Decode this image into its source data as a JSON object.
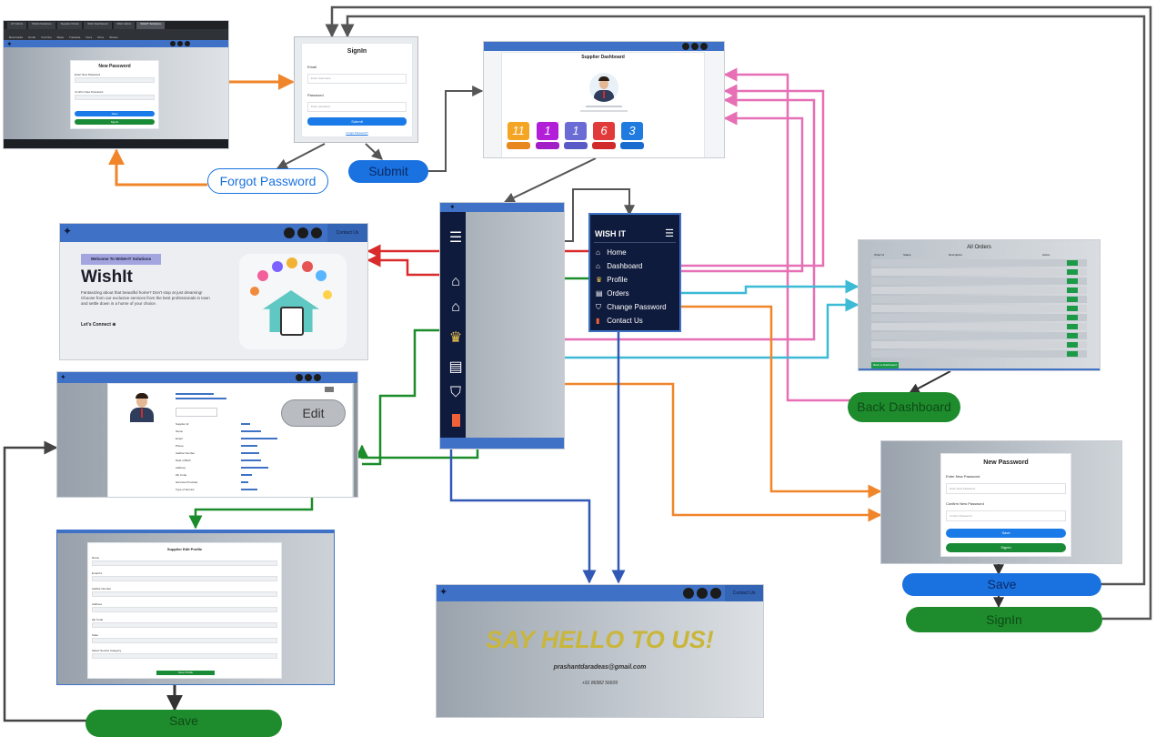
{
  "browser": {
    "tabs": [
      "sIT Admin",
      "Wishit Solutions",
      "Supplier Portal",
      "Wish Dashboard",
      "Wish Admin",
      "WishIT Solutions"
    ],
    "bookmarks": [
      "Bookmarks",
      "Gmail",
      "YouTube",
      "Maps",
      "Translate",
      "Docs",
      "Drive",
      "Sheets"
    ]
  },
  "forgot_page": {
    "title": "New Password",
    "label_new": "Enter New Password",
    "label_confirm": "Confirm New Password",
    "btn_save": "Save",
    "btn_signin": "SignIn"
  },
  "signin_page": {
    "title": "SignIn",
    "email_label": "Email",
    "email_placeholder": "Enter Username",
    "password_label": "Password",
    "password_placeholder": "Enter password",
    "submit": "Submit",
    "forgot_link": "Forgot Password?"
  },
  "dashboard_page": {
    "title": "Supplier Dashboard",
    "tiles": [
      {
        "value": "11",
        "color": "#f5a524"
      },
      {
        "value": "1",
        "color": "#b21fd8"
      },
      {
        "value": "1",
        "color": "#6b6bd6"
      },
      {
        "value": "6",
        "color": "#e03a3a"
      },
      {
        "value": "3",
        "color": "#1f7be0"
      }
    ]
  },
  "home_page": {
    "contact": "Contact Us",
    "banner": "Welcome To WISH-IT Solutions",
    "heading": "WishIt",
    "body": "Fantasizing about that beautiful home? Don't stop at just dreaming! Choose from our exclusive services from the best professionals in town and settle down in a home of your choice.",
    "cta": "Let's Connect"
  },
  "sidebar": {
    "brand": "WISH IT",
    "items": [
      "Home",
      "Dashboard",
      "Profile",
      "Orders",
      "Change Password",
      "Contact Us"
    ]
  },
  "orders_page": {
    "title": "All Orders",
    "columns": [
      "Order Id",
      "Status",
      "Description",
      "Action"
    ],
    "back": "Back to Dashboard"
  },
  "profile_page": {
    "fields": [
      "Supplier Id",
      "Name",
      "Email",
      "Phone",
      "Aadhar Number",
      "Date of Birth",
      "Address",
      "Zip Code",
      "Services Provided",
      "Type of Service"
    ]
  },
  "edit_profile_page": {
    "title": "Supplier Edit Profile",
    "fields": [
      "Name",
      "Email Id",
      "Aadhar Number",
      "Address",
      "Zip Code",
      "State",
      "Select Service Category"
    ],
    "save": "Save Profile"
  },
  "contact_page": {
    "headline": "SAY HELLO TO US!",
    "email": "prashantdaradeas@gmail.com",
    "phone": "+91 86982 56609",
    "contact": "Contact Us"
  },
  "new_password_page": {
    "title": "New Password",
    "label_new": "Enter New Password",
    "placeholder_new": "Enter New Password",
    "label_confirm": "Confirm New Password",
    "placeholder_confirm": "Confirm Password",
    "btn_save": "Save",
    "btn_signin": "SignIn"
  },
  "flow_labels": {
    "forgot_password": "Forgot Password",
    "submit": "Submit",
    "edit": "Edit",
    "back_dashboard": "Back Dashboard",
    "save_right": "Save",
    "signin_right": "SignIn",
    "save_bottom": "Save"
  },
  "colors": {
    "navy": "#0f1b3d",
    "nav_blue": "#3f72c6",
    "orange": "#f0852a",
    "pink": "#e66fb5",
    "green": "#1b8c2a",
    "red": "#d92b2b",
    "cyan": "#3cbad6",
    "blue_line": "#3158b5",
    "grey_line": "#555555",
    "flow_blue": "#1a72e0",
    "flow_green": "#1e8c2c"
  }
}
